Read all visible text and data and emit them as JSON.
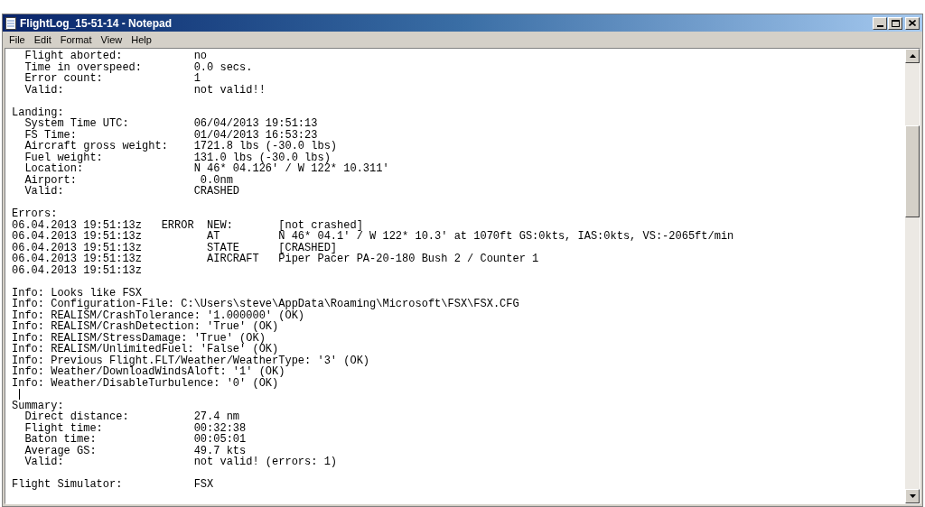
{
  "window": {
    "title": "FlightLog_15-51-14 - Notepad"
  },
  "menu": [
    "File",
    "Edit",
    "Format",
    "View",
    "Help"
  ],
  "blocks": [
    {
      "kind": "pair",
      "label": "  Flight aborted:",
      "value": "no"
    },
    {
      "kind": "pair",
      "label": "  Time in overspeed:",
      "value": "0.0 secs."
    },
    {
      "kind": "pair",
      "label": "  Error count:",
      "value": "1"
    },
    {
      "kind": "pair",
      "label": "  Valid:",
      "value": "not valid!!"
    },
    {
      "kind": "blank"
    },
    {
      "kind": "text",
      "text": "Landing:"
    },
    {
      "kind": "pair",
      "label": "  System Time UTC:",
      "value": "06/04/2013 19:51:13"
    },
    {
      "kind": "pair",
      "label": "  FS Time:",
      "value": "01/04/2013 16:53:23"
    },
    {
      "kind": "pair",
      "label": "  Aircraft gross weight:",
      "value": "1721.8 lbs (-30.0 lbs)"
    },
    {
      "kind": "pair",
      "label": "  Fuel weight:",
      "value": "131.0 lbs (-30.0 lbs)"
    },
    {
      "kind": "pair",
      "label": "  Location:",
      "value": "N 46* 04.126' / W 122* 10.311'"
    },
    {
      "kind": "pair",
      "label": "  Airport:",
      "value": " 0.0nm"
    },
    {
      "kind": "pair",
      "label": "  Valid:",
      "value": "CRASHED"
    },
    {
      "kind": "blank"
    },
    {
      "kind": "text",
      "text": "Errors:"
    },
    {
      "kind": "error",
      "time": "06.04.2013 19:51:13z",
      "type": "ERROR",
      "field": "NEW:",
      "value": "[not crashed]"
    },
    {
      "kind": "error",
      "time": "06.04.2013 19:51:13z",
      "field": "AT",
      "value": "N 46* 04.1' / W 122* 10.3' at 1070ft GS:0kts, IAS:0kts, VS:-2065ft/min"
    },
    {
      "kind": "error",
      "time": "06.04.2013 19:51:13z",
      "field": "STATE",
      "value": "[CRASHED]"
    },
    {
      "kind": "error",
      "time": "06.04.2013 19:51:13z",
      "field": "AIRCRAFT",
      "value": "Piper Pacer PA-20-180 Bush 2 / Counter 1"
    },
    {
      "kind": "error",
      "time": "06.04.2013 19:51:13z"
    },
    {
      "kind": "blank"
    },
    {
      "kind": "text",
      "text": "Info: Looks like FSX"
    },
    {
      "kind": "text",
      "text": "Info: Configuration-File: C:\\Users\\steve\\AppData\\Roaming\\Microsoft\\FSX\\FSX.CFG"
    },
    {
      "kind": "text",
      "text": "Info: REALISM/CrashTolerance: '1.000000' (OK)"
    },
    {
      "kind": "text",
      "text": "Info: REALISM/CrashDetection: 'True' (OK)"
    },
    {
      "kind": "text",
      "text": "Info: REALISM/StressDamage: 'True' (OK)"
    },
    {
      "kind": "text",
      "text": "Info: REALISM/UnlimitedFuel: 'False' (OK)"
    },
    {
      "kind": "text",
      "text": "Info: Previous Flight.FLT/Weather/WeatherType: '3' (OK)"
    },
    {
      "kind": "text",
      "text": "Info: Weather/DownloadWindsAloft: '1' (OK)"
    },
    {
      "kind": "text",
      "text": "Info: Weather/DisableTurbulence: '0' (OK)"
    },
    {
      "kind": "caret"
    },
    {
      "kind": "text",
      "text": "Summary:"
    },
    {
      "kind": "pair",
      "label": "  Direct distance:",
      "value": "27.4 nm"
    },
    {
      "kind": "pair",
      "label": "  Flight time:",
      "value": "00:32:38"
    },
    {
      "kind": "pair",
      "label": "  Baton time:",
      "value": "00:05:01"
    },
    {
      "kind": "pair",
      "label": "  Average GS:",
      "value": "49.7 kts"
    },
    {
      "kind": "pair",
      "label": "  Valid:",
      "value": "not valid! (errors: 1)"
    },
    {
      "kind": "blank"
    },
    {
      "kind": "pair",
      "label": "Flight Simulator:",
      "value": "FSX"
    }
  ]
}
